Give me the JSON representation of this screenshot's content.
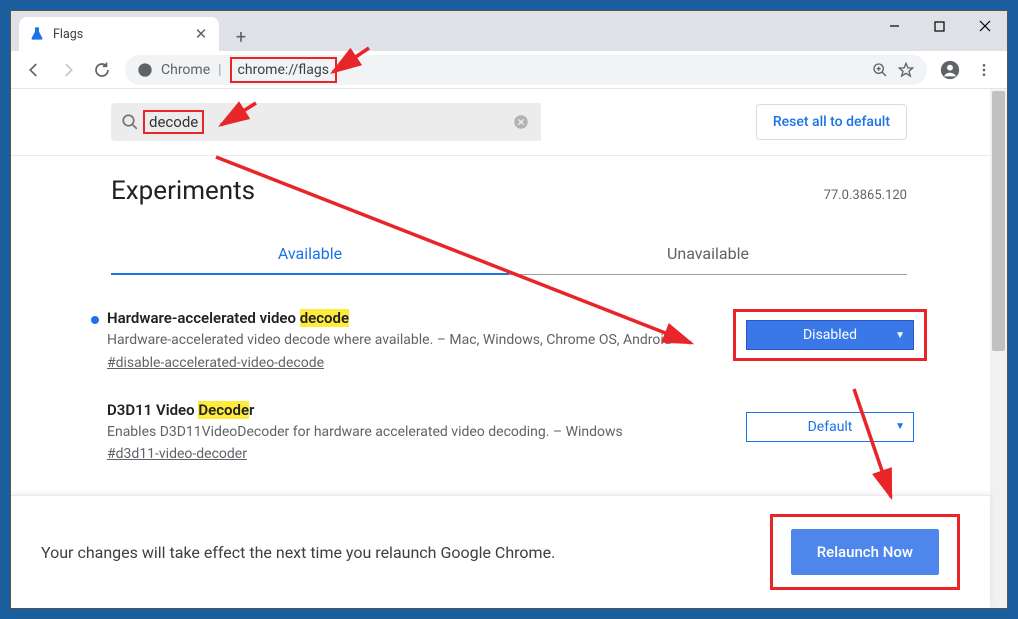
{
  "window": {
    "tab_title": "Flags"
  },
  "omnibox": {
    "chip": "Chrome",
    "url": "chrome://flags"
  },
  "search": {
    "value": "decode"
  },
  "actions": {
    "reset": "Reset all to default",
    "relaunch": "Relaunch Now"
  },
  "header": {
    "title": "Experiments",
    "version": "77.0.3865.120"
  },
  "tabs": {
    "available": "Available",
    "unavailable": "Unavailable"
  },
  "flags": [
    {
      "title_pre": "Hardware-accelerated video ",
      "title_hl": "decode",
      "title_post": "",
      "desc": "Hardware-accelerated video decode where available. – Mac, Windows, Chrome OS, Android",
      "hash": "#disable-accelerated-video-decode",
      "value": "Disabled",
      "modified": true
    },
    {
      "title_pre": "D3D11 Video ",
      "title_hl": "Decode",
      "title_post": "r",
      "desc": "Enables D3D11VideoDecoder for hardware accelerated video decoding. – Windows",
      "hash": "#d3d11-video-decoder",
      "value": "Default",
      "modified": false
    }
  ],
  "footer": {
    "message": "Your changes will take effect the next time you relaunch Google Chrome."
  }
}
